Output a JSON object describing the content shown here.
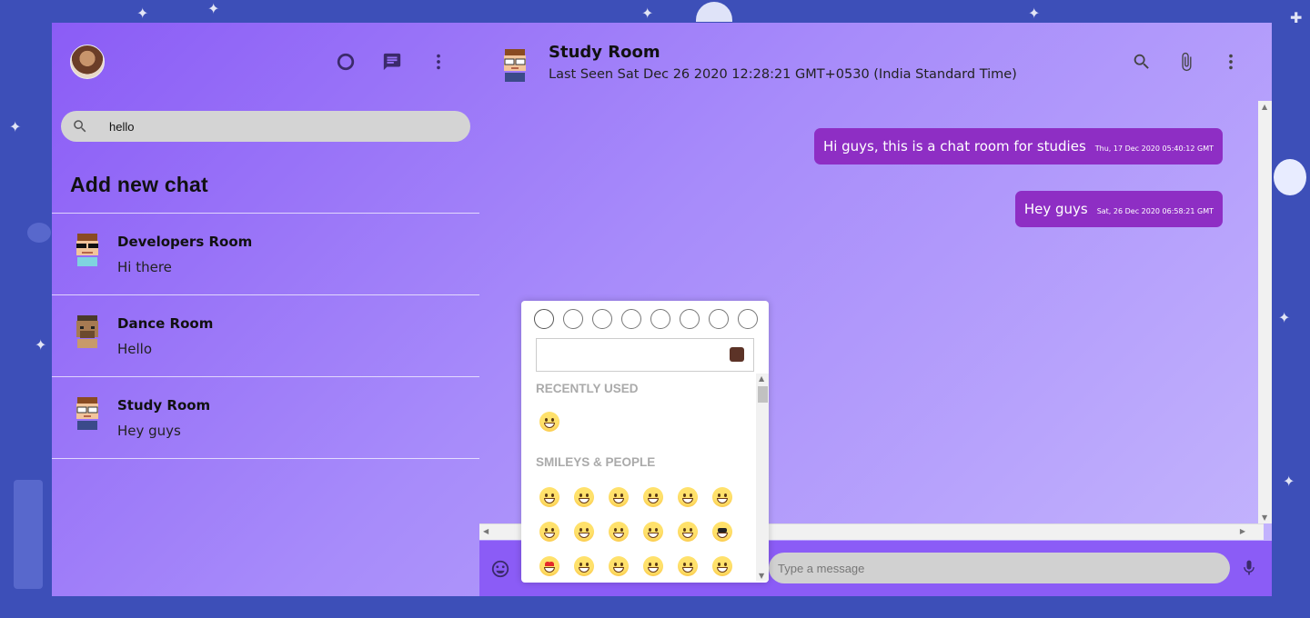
{
  "colors": {
    "accent": "#8b5cf6",
    "bubble": "#8e2ec4",
    "page_bg": "#3d4fb8"
  },
  "sidebar": {
    "header_icons": [
      "status-icon",
      "chat-icon",
      "more-vert-icon"
    ],
    "search": {
      "value": "hello",
      "placeholder": ""
    },
    "add_chat_label": "Add new chat",
    "chats": [
      {
        "name": "Developers Room",
        "last_message": "Hi there",
        "avatar": "avatar-sunglasses"
      },
      {
        "name": "Dance Room",
        "last_message": "Hello",
        "avatar": "avatar-brown"
      },
      {
        "name": "Study Room",
        "last_message": "Hey guys",
        "avatar": "avatar-glasses"
      }
    ]
  },
  "chat": {
    "title": "Study Room",
    "last_seen": "Last Seen Sat Dec 26 2020 12:28:21 GMT+0530 (India Standard Time)",
    "header_icons": [
      "search-icon",
      "attach-icon",
      "more-vert-icon"
    ],
    "messages": [
      {
        "text": "Hi guys, this is a chat room for studies",
        "timestamp": "Thu, 17 Dec 2020 05:40:12 GMT"
      },
      {
        "text": "Hey guys",
        "timestamp": "Sat, 26 Dec 2020 06:58:21 GMT"
      }
    ],
    "input_placeholder": "Type a message"
  },
  "emoji_picker": {
    "categories": [
      "people",
      "nature",
      "food",
      "activity",
      "travel",
      "objects",
      "symbols",
      "flags"
    ],
    "recently_used_label": "RECENTLY USED",
    "smileys_label": "SMILEYS & PEOPLE",
    "recent": [
      "😁"
    ],
    "smileys": [
      "😀",
      "😁",
      "😂",
      "🤣",
      "😃",
      "😄",
      "😅",
      "😆",
      "😉",
      "😊",
      "😋",
      "😎",
      "😍",
      "😘",
      "😗",
      "😙",
      "😚",
      "☺️"
    ]
  }
}
